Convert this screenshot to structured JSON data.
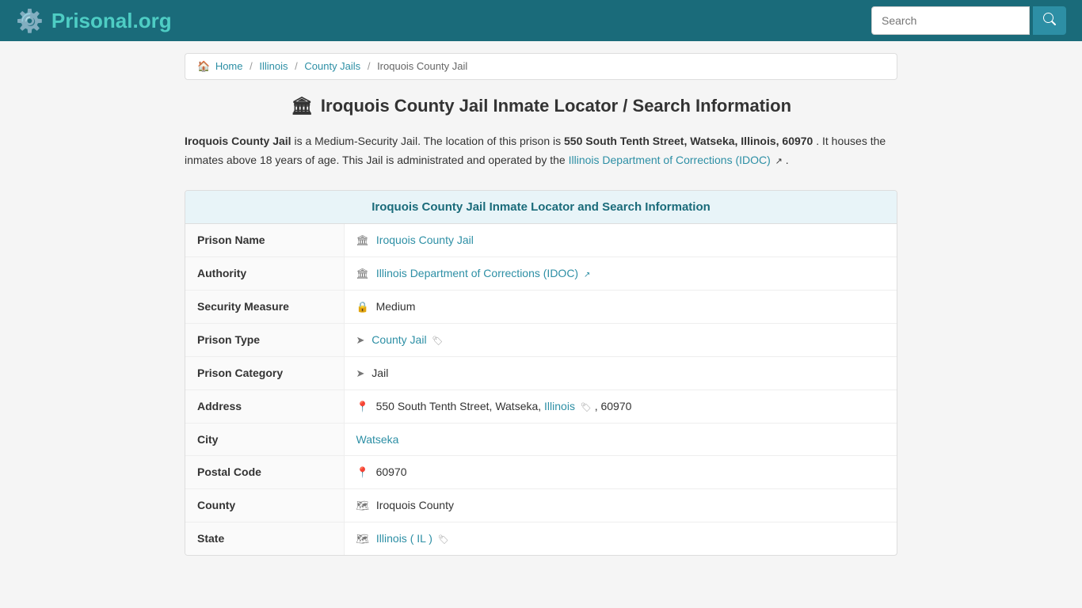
{
  "header": {
    "logo_text": "Prisonal",
    "logo_domain": ".org",
    "logo_icon": "⚙",
    "search_placeholder": "Search",
    "search_button_label": "🔍"
  },
  "breadcrumb": {
    "home_label": "Home",
    "items": [
      "Illinois",
      "County Jails",
      "Iroquois County Jail"
    ]
  },
  "page": {
    "title": "Iroquois County Jail Inmate Locator / Search Information",
    "title_icon": "🏛",
    "description_part1": " is a Medium-Security Jail. The location of this prison is ",
    "address_bold": "550 South Tenth Street, Watseka, Illinois, 60970",
    "description_part2": ". It houses the inmates above 18 years of age. This Jail is administrated and operated by the ",
    "idoc_link_text": "Illinois Department of Corrections (IDOC)",
    "description_end": "."
  },
  "table": {
    "card_header": "Iroquois County Jail Inmate Locator and Search Information",
    "rows": [
      {
        "label": "Prison Name",
        "icon": "🏛",
        "value": "Iroquois County Jail",
        "link": true,
        "ext": false
      },
      {
        "label": "Authority",
        "icon": "🏛",
        "value": "Illinois Department of Corrections (IDOC)",
        "link": true,
        "ext": true
      },
      {
        "label": "Security Measure",
        "icon": "🔒",
        "value": "Medium",
        "link": false,
        "ext": false
      },
      {
        "label": "Prison Type",
        "icon": "➤",
        "value": "County Jail",
        "link": true,
        "ext": true,
        "tag": true
      },
      {
        "label": "Prison Category",
        "icon": "➤",
        "value": "Jail",
        "link": false,
        "ext": false
      },
      {
        "label": "Address",
        "icon": "📍",
        "value": "550 South Tenth Street, Watseka, ",
        "value_link_mid": "Illinois",
        "value_end": ", 60970",
        "link": false,
        "ext": false,
        "mixed": true
      },
      {
        "label": "City",
        "icon": "",
        "value": "Watseka",
        "link": true,
        "ext": false
      },
      {
        "label": "Postal Code",
        "icon": "📍",
        "value": "60970",
        "link": false,
        "ext": false
      },
      {
        "label": "County",
        "icon": "🗺",
        "value": "Iroquois County",
        "link": false,
        "ext": false
      },
      {
        "label": "State",
        "icon": "🗺",
        "value": "Illinois ( IL )",
        "link": true,
        "ext": false,
        "tag": true
      }
    ]
  }
}
